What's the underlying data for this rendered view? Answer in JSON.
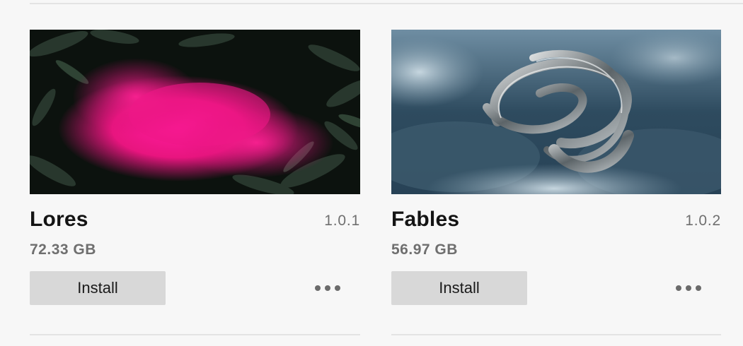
{
  "cards": [
    {
      "title": "Lores",
      "version": "1.0.1",
      "size": "72.33 GB",
      "install_label": "Install",
      "thumbnail": "pink-smoke-fern-leaves"
    },
    {
      "title": "Fables",
      "version": "1.0.2",
      "size": "56.97 GB",
      "install_label": "Install",
      "thumbnail": "metal-ribbon-sculpture-clouds"
    }
  ],
  "icons": {
    "more": "more-horizontal-icon"
  },
  "colors": {
    "background": "#f7f7f7",
    "button": "#d8d8d8",
    "muted_text": "#6f6f6f",
    "title_text": "#141414"
  }
}
